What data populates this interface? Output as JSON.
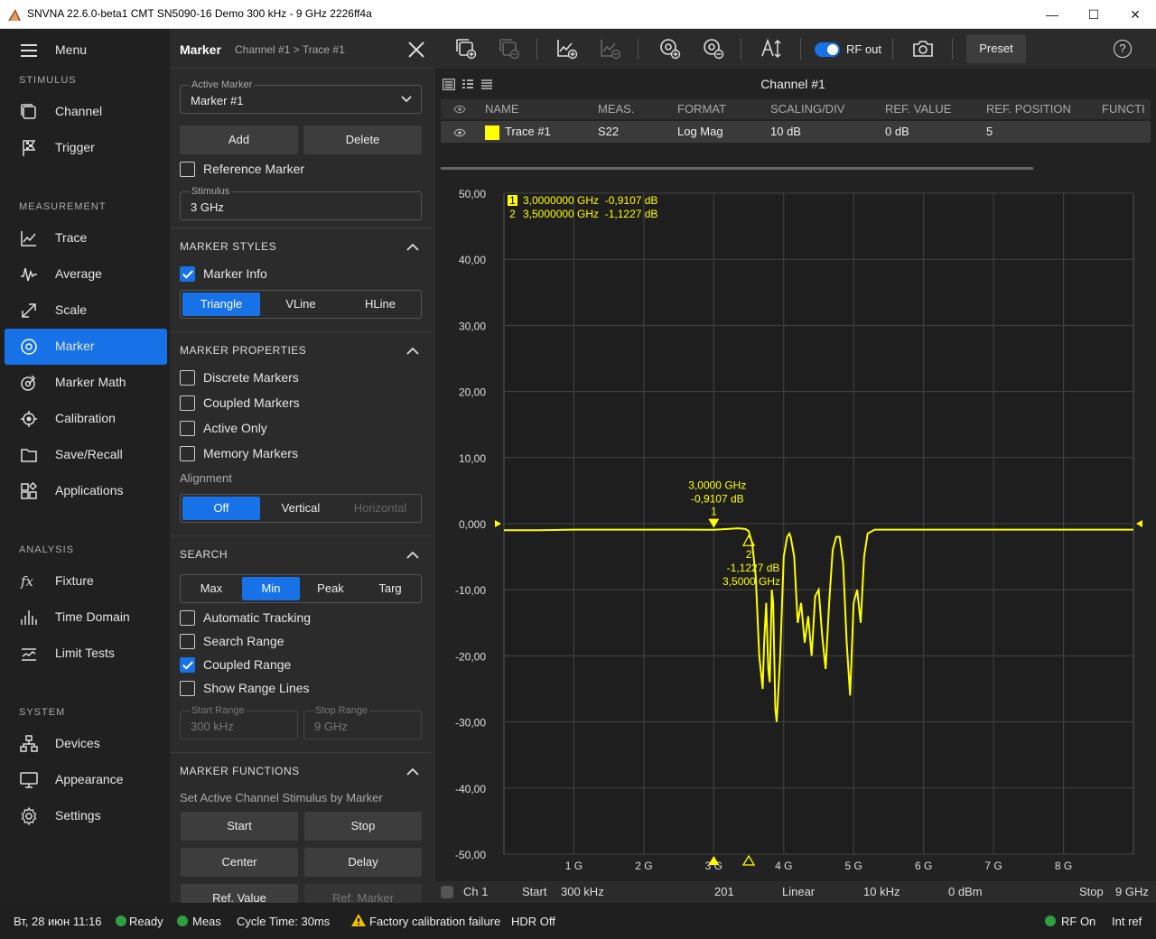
{
  "window": {
    "title": "SNVNA 22.6.0-beta1 CMT SN5090-16 Demo 300 kHz - 9 GHz 2226ff4a",
    "minimize": "—",
    "maximize": "☐",
    "close": "✕"
  },
  "sidebar": {
    "menu_label": "Menu",
    "sections": {
      "stimulus": "STIMULUS",
      "measurement": "MEASUREMENT",
      "analysis": "ANALYSIS",
      "system": "SYSTEM"
    },
    "items": {
      "channel": "Channel",
      "trigger": "Trigger",
      "trace": "Trace",
      "average": "Average",
      "scale": "Scale",
      "marker": "Marker",
      "marker_math": "Marker Math",
      "calibration": "Calibration",
      "save_recall": "Save/Recall",
      "applications": "Applications",
      "fixture": "Fixture",
      "time_domain": "Time Domain",
      "limit_tests": "Limit Tests",
      "devices": "Devices",
      "appearance": "Appearance",
      "settings": "Settings"
    }
  },
  "panel": {
    "title": "Marker",
    "crumb": "Channel #1  >  Trace #1",
    "active_marker_label": "Active Marker",
    "active_marker_value": "Marker #1",
    "add": "Add",
    "delete": "Delete",
    "reference_marker": "Reference Marker",
    "stimulus_label": "Stimulus",
    "stimulus_value": "3 GHz",
    "marker_styles": "MARKER STYLES",
    "marker_info": "Marker Info",
    "style_options": [
      "Triangle",
      "VLine",
      "HLine"
    ],
    "marker_properties": "MARKER PROPERTIES",
    "discrete": "Discrete Markers",
    "coupled": "Coupled Markers",
    "active_only": "Active Only",
    "memory": "Memory Markers",
    "alignment": "Alignment",
    "alignment_options": [
      "Off",
      "Vertical",
      "Horizontal"
    ],
    "search": "SEARCH",
    "search_options": [
      "Max",
      "Min",
      "Peak",
      "Targ"
    ],
    "auto_tracking": "Automatic Tracking",
    "search_range": "Search Range",
    "coupled_range": "Coupled Range",
    "show_range_lines": "Show Range Lines",
    "start_range_label": "Start Range",
    "start_range_value": "300 kHz",
    "stop_range_label": "Stop Range",
    "stop_range_value": "9 GHz",
    "marker_functions": "MARKER FUNCTIONS",
    "set_active": "Set Active Channel Stimulus by Marker",
    "start": "Start",
    "stop": "Stop",
    "center": "Center",
    "delay": "Delay",
    "ref_value": "Ref. Value",
    "ref_marker": "Ref. Marker"
  },
  "toolbar": {
    "rf_out": "RF out",
    "preset": "Preset",
    "help": "?"
  },
  "channel": {
    "title": "Channel #1",
    "headers": [
      "NAME",
      "MEAS.",
      "FORMAT",
      "SCALING/DIV",
      "REF. VALUE",
      "REF. POSITION",
      "FUNCTI"
    ],
    "row": {
      "name": "Trace #1",
      "meas": "S22",
      "format": "Log Mag",
      "scaling": "10 dB",
      "ref_value": "0 dB",
      "ref_position": "5"
    },
    "trace_color": "#ffff00"
  },
  "chart_data": {
    "type": "line",
    "xlim": [
      0.0003,
      9
    ],
    "ylim": [
      -50,
      50
    ],
    "y_ticks": [
      "50,00",
      "40,00",
      "30,00",
      "20,00",
      "10,00",
      "0,000",
      "-10,00",
      "-20,00",
      "-30,00",
      "-40,00",
      "-50,00"
    ],
    "x_ticks": [
      "1 G",
      "2 G",
      "3 G",
      "4 G",
      "5 G",
      "6 G",
      "7 G",
      "8 G"
    ],
    "grid": true,
    "series": [
      {
        "x": [
          0.0003,
          0.5,
          1.0,
          1.5,
          2.0,
          2.5,
          3.0,
          3.2,
          3.35,
          3.45,
          3.5,
          3.55,
          3.6,
          3.65,
          3.7,
          3.72,
          3.75,
          3.78,
          3.8,
          3.83,
          3.85,
          3.88,
          3.9,
          3.95,
          4.0,
          4.05,
          4.08,
          4.1,
          4.15,
          4.2,
          4.25,
          4.3,
          4.35,
          4.4,
          4.45,
          4.5,
          4.55,
          4.6,
          4.65,
          4.7,
          4.75,
          4.8,
          4.85,
          4.9,
          4.95,
          5.0,
          5.05,
          5.1,
          5.15,
          5.2,
          5.3,
          5.4,
          5.5,
          6.0,
          6.5,
          7.0,
          7.5,
          8.0,
          8.5,
          9.0
        ],
        "y": [
          -1.0,
          -1.0,
          -0.9,
          -0.9,
          -0.9,
          -0.9,
          -0.91,
          -0.8,
          -0.7,
          -0.8,
          -1.12,
          -3,
          -8,
          -20,
          -25,
          -18,
          -12,
          -22,
          -24,
          -10,
          -12,
          -28,
          -30,
          -20,
          -5,
          -2,
          -1.5,
          -2,
          -5,
          -15,
          -12,
          -18,
          -14,
          -20,
          -11,
          -10,
          -17,
          -22,
          -12,
          -4,
          -2,
          -2,
          -6,
          -18,
          -26,
          -12,
          -10,
          -15,
          -5,
          -1.5,
          -0.9,
          -0.9,
          -0.9,
          -0.9,
          -0.9,
          -0.9,
          -0.9,
          -0.9,
          -0.9,
          -0.9
        ]
      }
    ],
    "markers": [
      {
        "id": "1",
        "x": 3.0,
        "y": -0.9107,
        "freq_label": "3,0000 GHz",
        "val_label": "-0,9107 dB",
        "readout": "3,0000000 GHz  -0,9107 dB"
      },
      {
        "id": "2",
        "x": 3.5,
        "y": -1.1227,
        "freq_label": "3,5000 GHz",
        "val_label": "-1,1227 dB",
        "readout": "3,5000000 GHz  -1,1227 dB"
      }
    ]
  },
  "bottom": {
    "ch": "Ch 1",
    "start_label": "Start",
    "start": "300 kHz",
    "points": "201",
    "sweep": "Linear",
    "ifbw": "10 kHz",
    "power": "0 dBm",
    "stop_label": "Stop",
    "stop": "9 GHz"
  },
  "status": {
    "datetime": "Вт, 28 июн 11:16",
    "ready": "Ready",
    "meas": "Meas",
    "cycle": "Cycle Time: 30ms",
    "warning": "Factory calibration failure",
    "hdr": "HDR Off",
    "rf_on": "RF On",
    "int_ref": "Int ref"
  }
}
